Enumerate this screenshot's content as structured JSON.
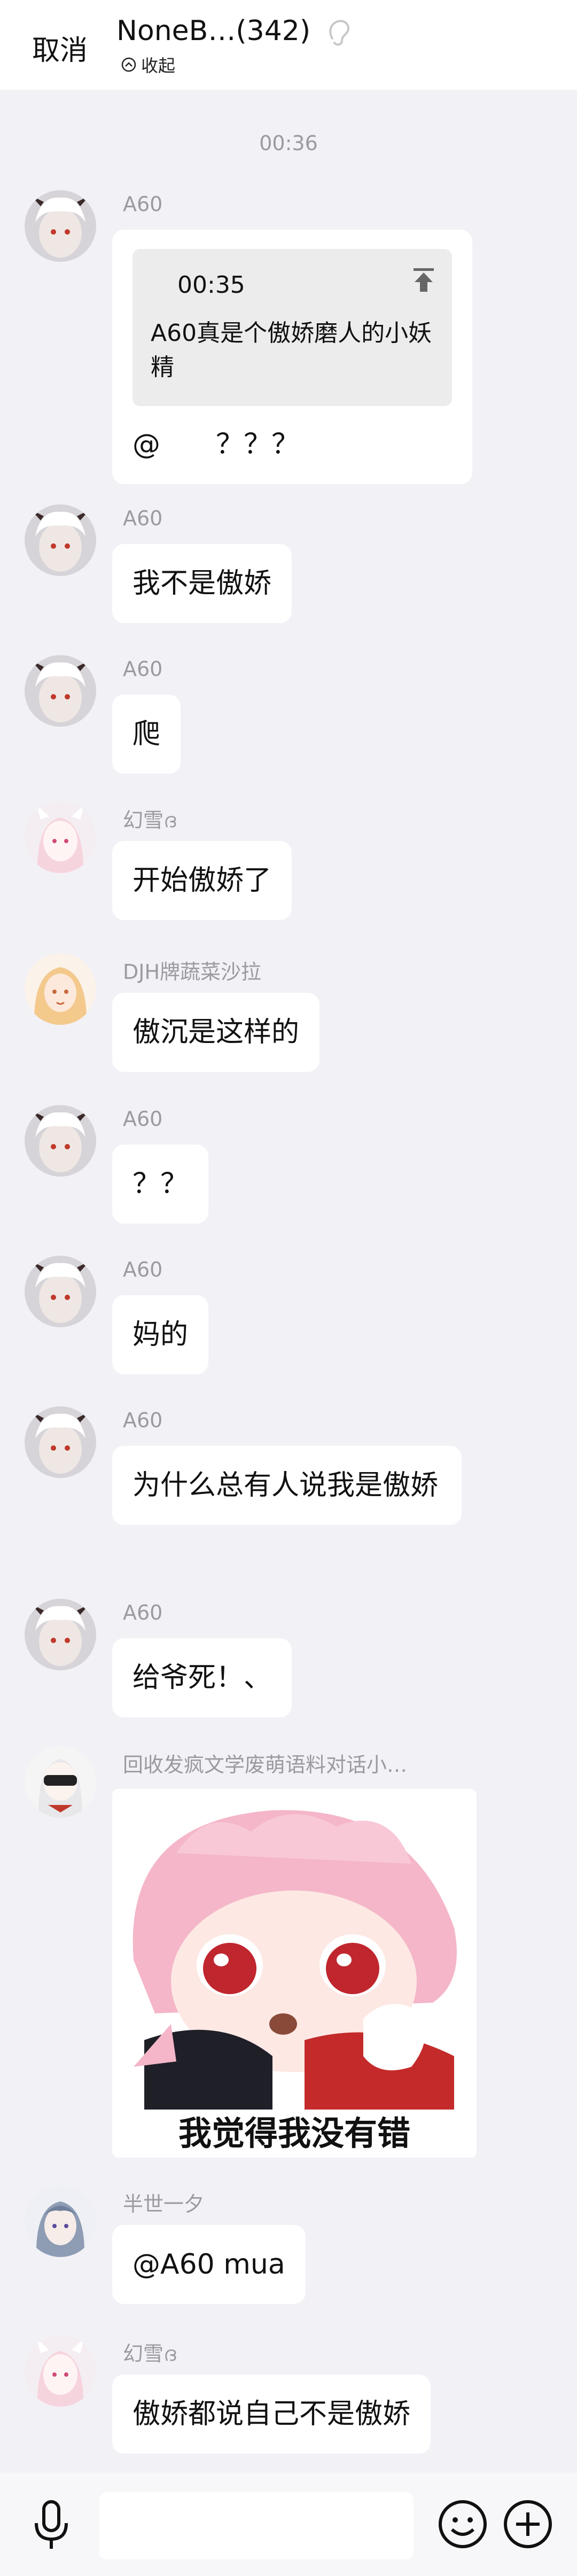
{
  "header": {
    "cancel_label": "取消",
    "title": "NoneB…(342)",
    "collapse_label": "收起"
  },
  "timestamp": "00:36",
  "messages": [
    {
      "sender": "A60",
      "quote_time": "00:35",
      "quote_text": "A60真是个傲娇磨人的小妖精",
      "text": "@　　？？？"
    },
    {
      "sender": "A60",
      "text": "我不是傲娇"
    },
    {
      "sender": "A60",
      "text": "爬"
    },
    {
      "sender": "幻雪ദ",
      "text": "开始傲娇了"
    },
    {
      "sender": "DJH牌蔬菜沙拉",
      "text": "傲沉是这样的"
    },
    {
      "sender": "A60",
      "text": "？？"
    },
    {
      "sender": "A60",
      "text": "妈的"
    },
    {
      "sender": "A60",
      "text": "为什么总有人说我是傲娇"
    },
    {
      "sender": "A60",
      "text": "给爷死！、"
    },
    {
      "sender": "回收发疯文学废萌语料对话小…",
      "sticker_caption": "我觉得我没有错"
    },
    {
      "sender": "半世一夕",
      "text": "@A60 mua"
    },
    {
      "sender": "幻雪ദ",
      "text": "傲娇都说自己不是傲娇"
    }
  ],
  "colors": {
    "background": "#f2f1f6",
    "bubble": "#ffffff",
    "meta_text": "#9a9aa0"
  }
}
